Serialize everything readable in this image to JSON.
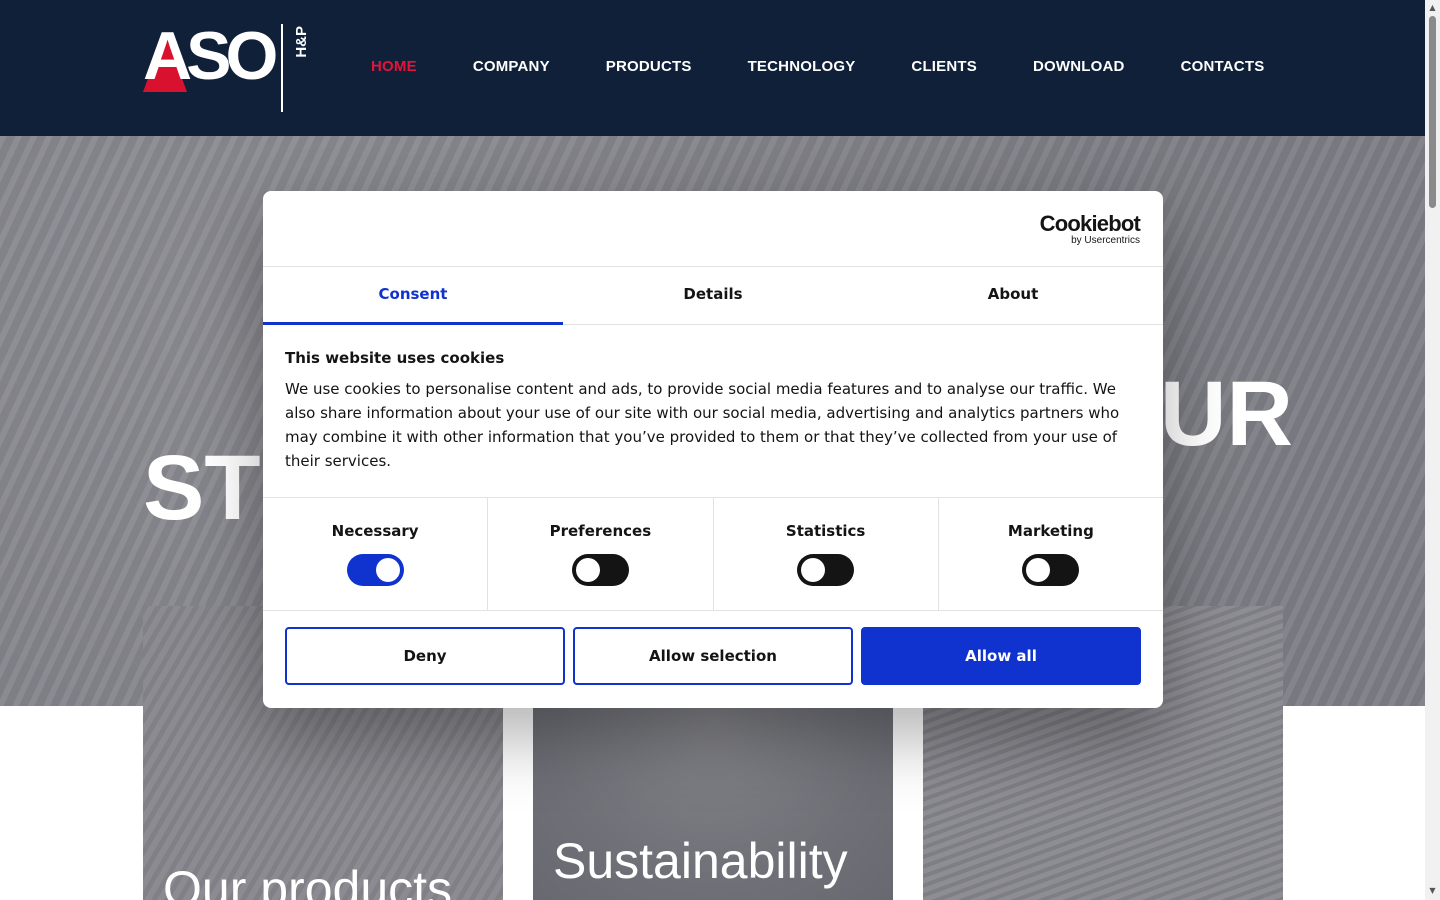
{
  "header": {
    "logo_text": "ASO",
    "logo_sub": "H&P",
    "nav": [
      {
        "label": "HOME"
      },
      {
        "label": "COMPANY"
      },
      {
        "label": "PRODUCTS"
      },
      {
        "label": "TECHNOLOGY"
      },
      {
        "label": "CLIENTS"
      },
      {
        "label": "DOWNLOAD"
      },
      {
        "label": "CONTACTS"
      }
    ],
    "active_nav": "HOME",
    "colors": {
      "background": "#0f2038",
      "active": "#e0153a"
    }
  },
  "hero": {
    "text_left": "ST",
    "text_right": "UR"
  },
  "cards": [
    {
      "title": "Our products"
    },
    {
      "title": "Sustainability"
    },
    {
      "title": ""
    }
  ],
  "cookie_dialog": {
    "brand": "Cookiebot",
    "brand_sub": "by Usercentrics",
    "tabs": [
      {
        "label": "Consent"
      },
      {
        "label": "Details"
      },
      {
        "label": "About"
      }
    ],
    "active_tab": "Consent",
    "title": "This website uses cookies",
    "text": "We use cookies to personalise content and ads, to provide social media features and to analyse our traffic. We also share information about your use of our site with our social media, advertising and analytics partners who may combine it with other information that you’ve provided to them or that they’ve collected from your use of their services.",
    "toggles": [
      {
        "label": "Necessary",
        "on": true
      },
      {
        "label": "Preferences",
        "on": false
      },
      {
        "label": "Statistics",
        "on": false
      },
      {
        "label": "Marketing",
        "on": false
      }
    ],
    "buttons": {
      "deny": "Deny",
      "allow_selection": "Allow selection",
      "allow_all": "Allow all"
    },
    "colors": {
      "accent": "#1032cf"
    }
  }
}
